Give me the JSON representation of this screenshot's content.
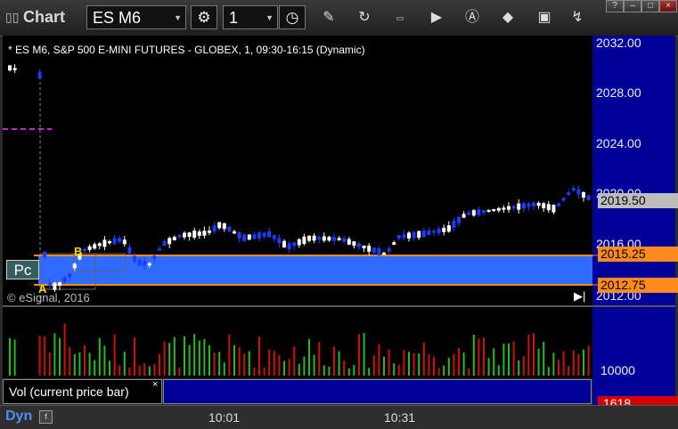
{
  "window": {
    "title": "Chart",
    "symbol": "ES M6",
    "interval": "1",
    "controls": [
      "minimize-icon",
      "maximize-icon",
      "close-icon"
    ]
  },
  "toolbar_icons": [
    "settings-icon",
    "clock-icon",
    "pencil-icon",
    "cursor-sync-icon",
    "study-icon",
    "play-icon",
    "alert-icon",
    "eraser-icon",
    "camera-icon"
  ],
  "chart": {
    "title": "* ES M6, S&P 500 E-MINI FUTURES - GLOBEX, 1, 09:30-16:15 (Dynamic)",
    "price_ticks": [
      "2032.00",
      "2028.00",
      "2024.00",
      "2020.00",
      "2016.00",
      "2012.00"
    ],
    "last_price": "2019.50",
    "pc_high": "2015.25",
    "pc_low": "2012.75",
    "pc_label": "Pc",
    "copyright": "© eSignal, 2016",
    "label_a": "A",
    "label_b": "B",
    "colors": {
      "up": "#ffffff",
      "down": "#1e3cff",
      "band": "#2f6bff",
      "band_edge": "#ff8a1e",
      "vol_up": "#1fbf1f",
      "vol_down": "#d01010",
      "dash": "#d01fd0"
    }
  },
  "volume": {
    "label": "Vol (current price bar)",
    "tick": "10000",
    "last": "1618"
  },
  "time_axis": {
    "mode": "Dyn",
    "labels": [
      "10:01",
      "10:31"
    ]
  },
  "chart_data": {
    "type": "candlestick",
    "title": "* ES M6, S&P 500 E-MINI FUTURES - GLOBEX, 1, 09:30-16:15 (Dynamic)",
    "ylim": [
      2011.5,
      2032.6
    ],
    "xlabels": [
      "10:01",
      "10:31"
    ],
    "last": 2019.5,
    "reference_band": [
      2012.75,
      2015.25
    ]
  }
}
